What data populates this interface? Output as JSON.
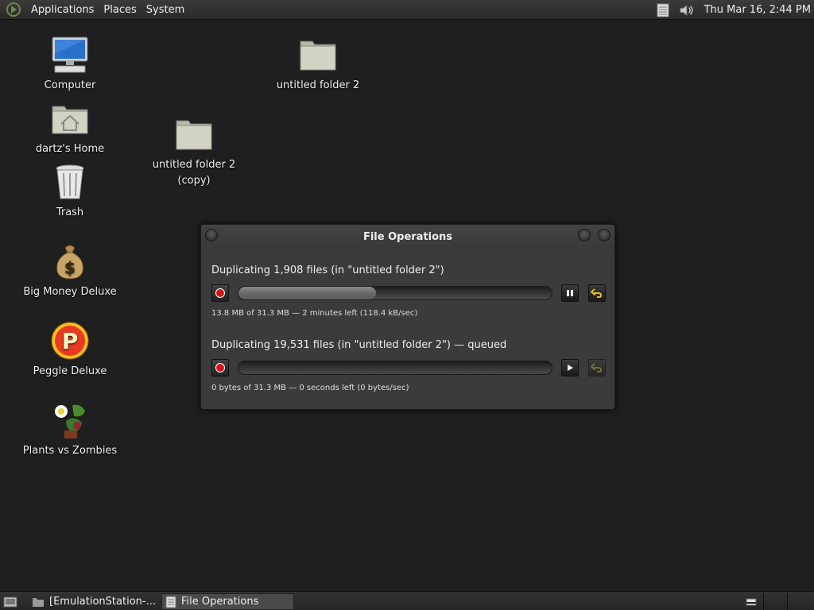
{
  "top_panel": {
    "menus": [
      "Applications",
      "Places",
      "System"
    ],
    "clock": "Thu Mar 16,  2:44 PM"
  },
  "desktop": {
    "icons": [
      {
        "label": "Computer"
      },
      {
        "label": "dartz's Home"
      },
      {
        "label": "Trash"
      },
      {
        "label": "Big Money Deluxe"
      },
      {
        "label": "Peggle Deluxe"
      },
      {
        "label": "Plants vs Zombies"
      },
      {
        "label": "untitled folder 2"
      },
      {
        "label": "untitled folder 2 (copy)"
      }
    ]
  },
  "dialog": {
    "title": "File Operations",
    "operations": [
      {
        "label": "Duplicating 1,908 files (in \"untitled folder 2\")",
        "status": "13.8 MB of 31.3 MB — 2 minutes left (118.4 kB/sec)",
        "progress": 0.44,
        "control": "pause"
      },
      {
        "label": "Duplicating 19,531 files (in \"untitled folder 2\") — queued",
        "status": "0 bytes of 31.3 MB — 0 seconds left (0 bytes/sec)",
        "progress": 0,
        "control": "play"
      }
    ]
  },
  "taskbar": {
    "tasks": [
      {
        "label": "[EmulationStation-..."
      },
      {
        "label": "File Operations"
      }
    ]
  },
  "colors": {
    "desktop_bg": "#1e1f1e",
    "record_red": "#d81414",
    "undo_yellow": "#e0c020"
  }
}
